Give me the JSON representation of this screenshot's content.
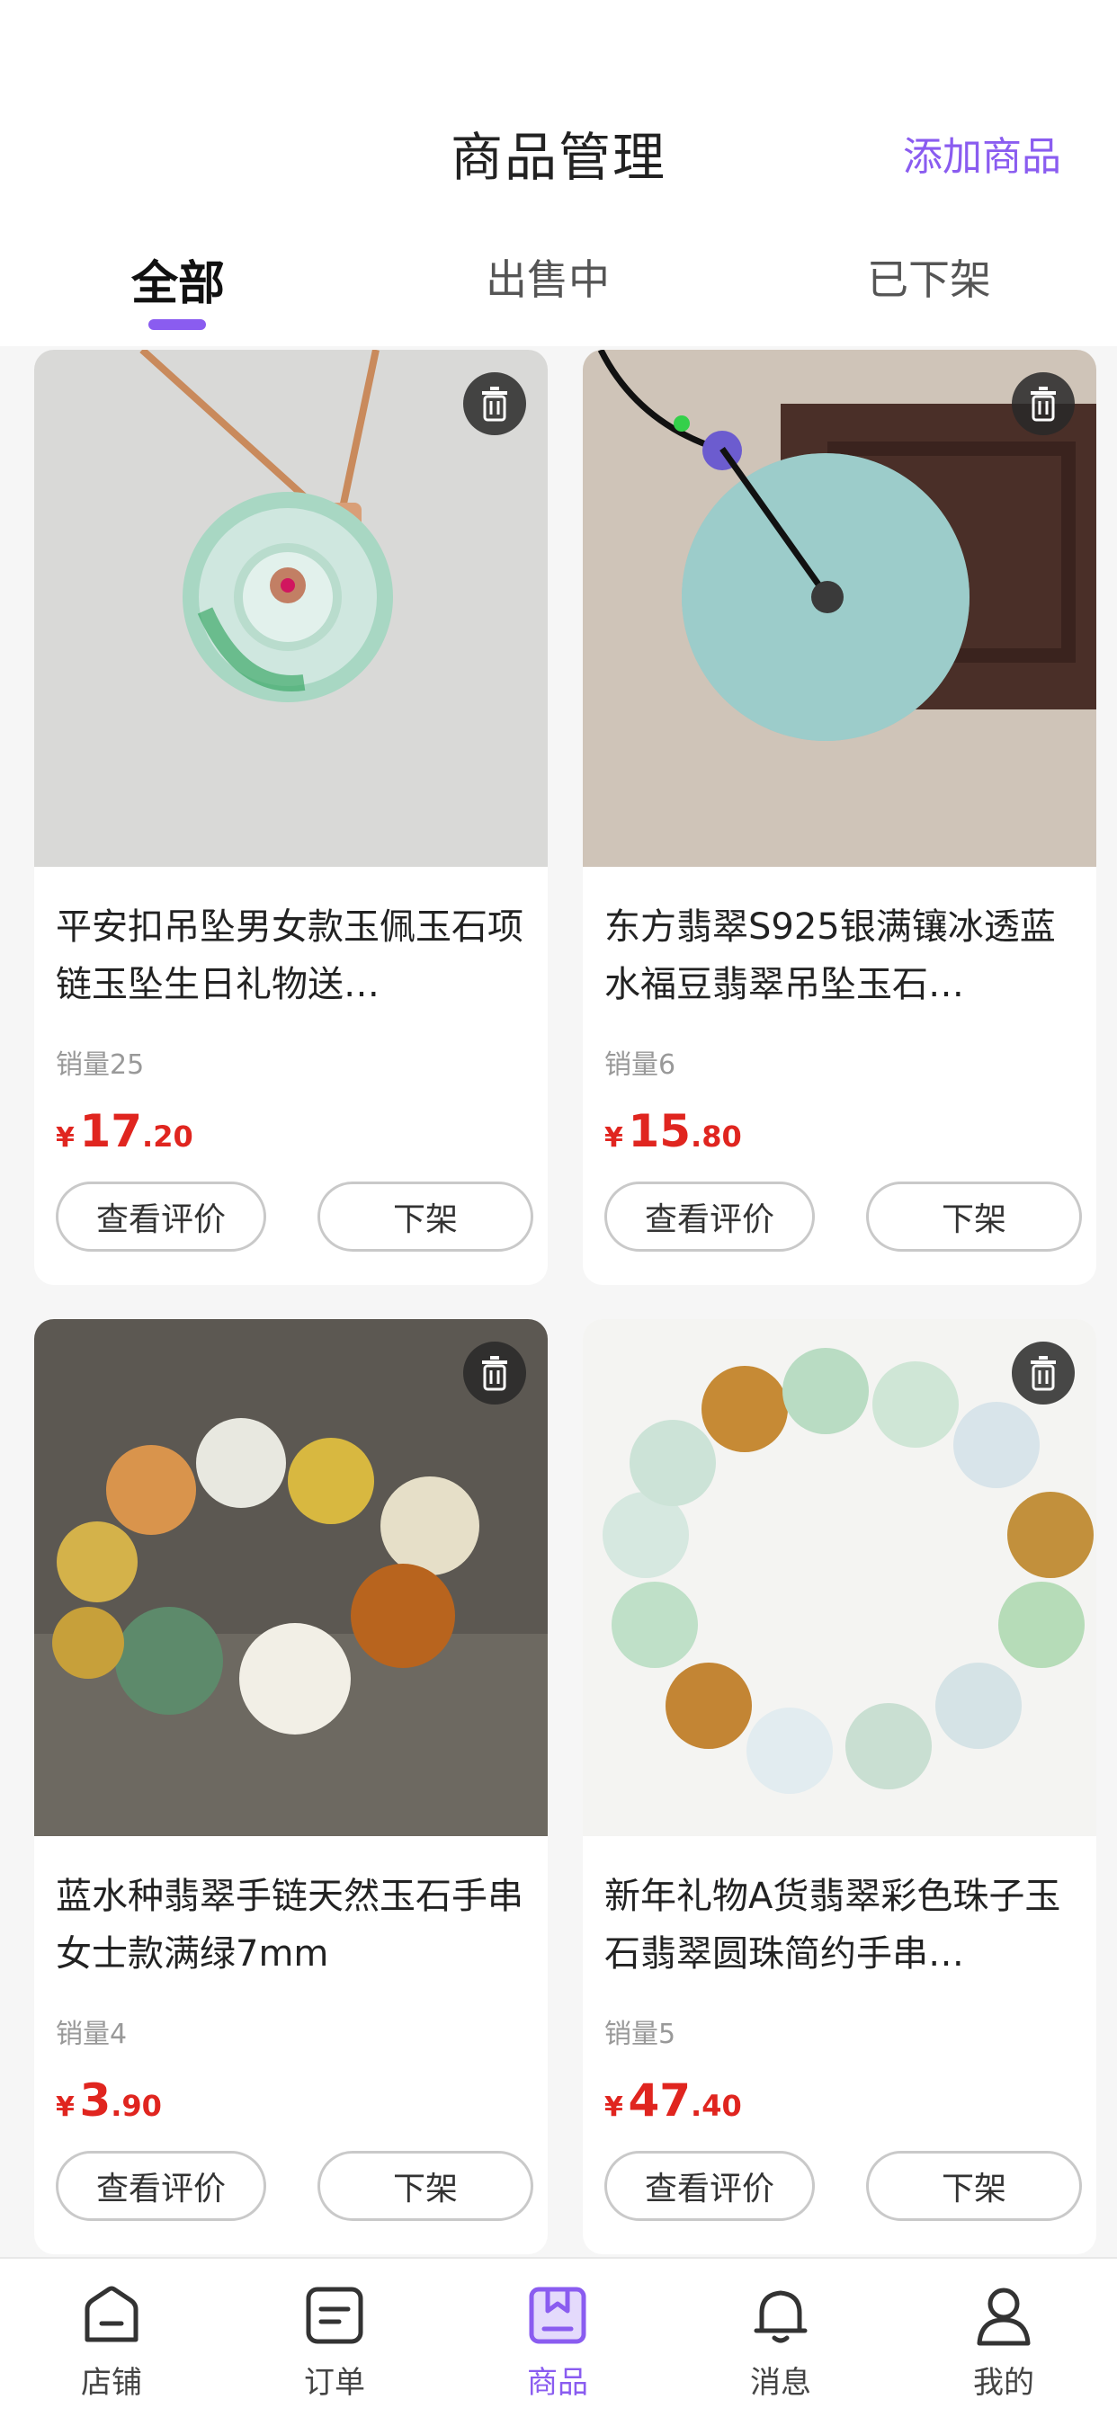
{
  "header": {
    "title": "商品管理",
    "add_label": "添加商品"
  },
  "tabs": [
    {
      "label": "全部",
      "active": true
    },
    {
      "label": "出售中",
      "active": false
    },
    {
      "label": "已下架",
      "active": false
    }
  ],
  "products": [
    {
      "title": "平安扣吊坠男女款玉佩玉石项链玉坠生日礼物送…",
      "sales": "销量25",
      "price_symbol": "¥",
      "price_int": "17",
      "price_dec": ".20",
      "review_label": "查看评价",
      "delist_label": "下架"
    },
    {
      "title": "东方翡翠S925银满镶冰透蓝水福豆翡翠吊坠玉石…",
      "sales": "销量6",
      "price_symbol": "¥",
      "price_int": "15",
      "price_dec": ".80",
      "review_label": "查看评价",
      "delist_label": "下架"
    },
    {
      "title": "蓝水种翡翠手链天然玉石手串女士款满绿7mm",
      "sales": "销量4",
      "price_symbol": "¥",
      "price_int": "3",
      "price_dec": ".90",
      "review_label": "查看评价",
      "delist_label": "下架"
    },
    {
      "title": "新年礼物A货翡翠彩色珠子玉石翡翠圆珠简约手串…",
      "sales": "销量5",
      "price_symbol": "¥",
      "price_int": "47",
      "price_dec": ".40",
      "review_label": "查看评价",
      "delist_label": "下架"
    }
  ],
  "tabbar": [
    {
      "label": "店铺",
      "icon": "shop-icon",
      "active": false
    },
    {
      "label": "订单",
      "icon": "order-icon",
      "active": false
    },
    {
      "label": "商品",
      "icon": "product-icon",
      "active": true
    },
    {
      "label": "消息",
      "icon": "bell-icon",
      "active": false
    },
    {
      "label": "我的",
      "icon": "user-icon",
      "active": false
    }
  ],
  "colors": {
    "accent": "#8a5cf0",
    "price": "#e0251f"
  }
}
